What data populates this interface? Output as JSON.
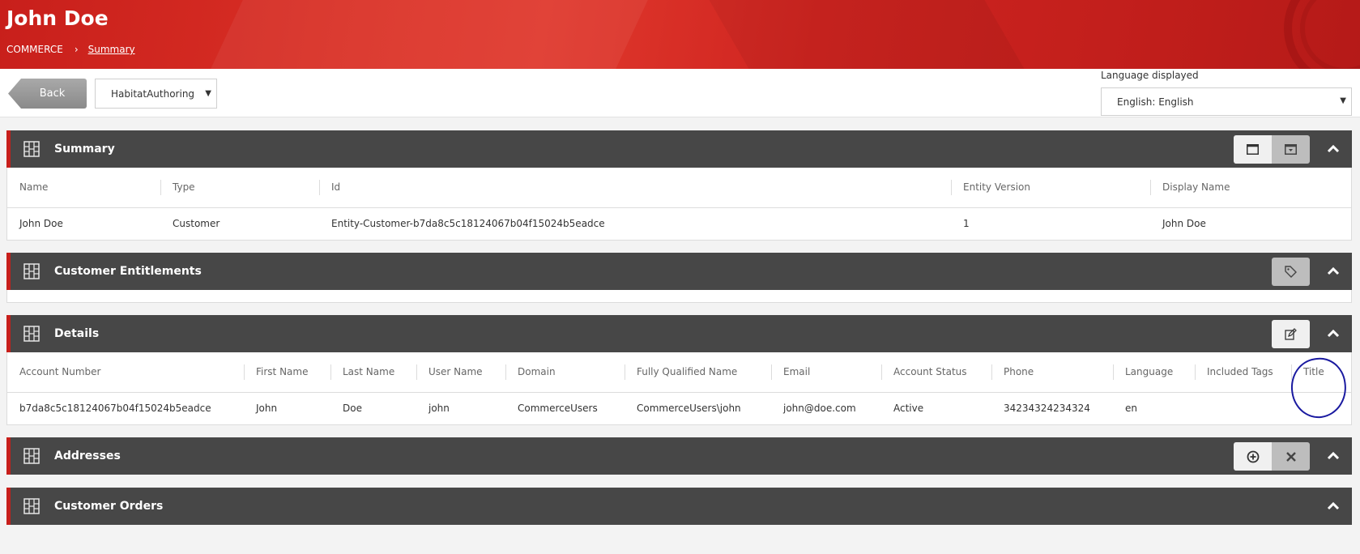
{
  "header": {
    "title": "John Doe",
    "breadcrumb": {
      "root": "COMMERCE",
      "separator": "›",
      "current": "Summary"
    }
  },
  "toolbar": {
    "back_label": "Back",
    "site_select": "HabitatAuthoring",
    "language_label": "Language displayed",
    "language_select": "English: English"
  },
  "summary": {
    "title": "Summary",
    "columns": [
      "Name",
      "Type",
      "Id",
      "Entity Version",
      "Display Name"
    ],
    "row": [
      "John Doe",
      "Customer",
      "Entity-Customer-b7da8c5c18124067b04f15024b5eadce",
      "1",
      "John Doe"
    ]
  },
  "entitlements": {
    "title": "Customer Entitlements"
  },
  "details": {
    "title": "Details",
    "columns": [
      "Account Number",
      "First Name",
      "Last Name",
      "User Name",
      "Domain",
      "Fully Qualified Name",
      "Email",
      "Account Status",
      "Phone",
      "Language",
      "Included Tags",
      "Title"
    ],
    "row": [
      "b7da8c5c18124067b04f15024b5eadce",
      "John",
      "Doe",
      "john",
      "CommerceUsers",
      "CommerceUsers\\john",
      "john@doe.com",
      "Active",
      "34234324234324",
      "en",
      "",
      ""
    ]
  },
  "addresses": {
    "title": "Addresses"
  },
  "orders": {
    "title": "Customer Orders"
  },
  "colors": {
    "brand_red": "#c71f1b",
    "panel_dark": "#474747",
    "annotation_blue": "#1a1aa0"
  }
}
